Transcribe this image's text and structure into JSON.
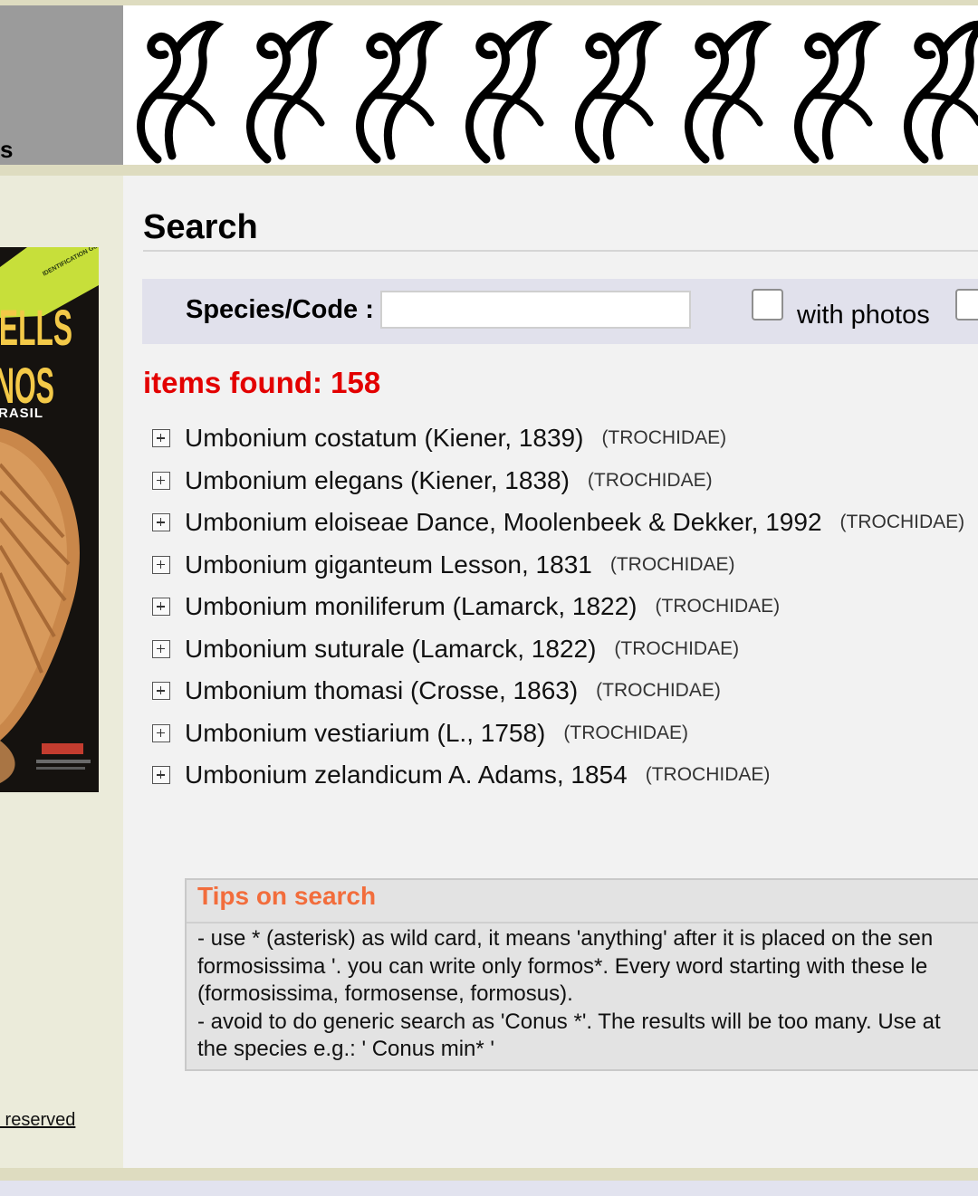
{
  "header": {
    "left_text": "s",
    "banner_icon": "decorative-wave-pattern-icon"
  },
  "sidebar": {
    "book_cover": {
      "title_line1": "HELLS",
      "title_line2": "NOS",
      "title_line3": "RASIL",
      "ribbon": "IDENTIFICATION GUIDE"
    },
    "footer_link": "s reserved"
  },
  "main": {
    "title": "Search",
    "search": {
      "species_label": "Species/Code :",
      "species_value": "",
      "with_photos_label": "with photos",
      "with_photos_checked": false
    },
    "items_found_label": "items found:",
    "items_found_count": "158",
    "results": [
      {
        "name": "Umbonium costatum (Kiener, 1839)",
        "family": "(TROCHIDAE)"
      },
      {
        "name": "Umbonium elegans (Kiener, 1838)",
        "family": "(TROCHIDAE)"
      },
      {
        "name": "Umbonium eloiseae Dance, Moolenbeek & Dekker, 1992",
        "family": "(TROCHIDAE)"
      },
      {
        "name": "Umbonium giganteum Lesson, 1831",
        "family": "(TROCHIDAE)"
      },
      {
        "name": "Umbonium moniliferum (Lamarck, 1822)",
        "family": "(TROCHIDAE)"
      },
      {
        "name": "Umbonium suturale (Lamarck, 1822)",
        "family": "(TROCHIDAE)"
      },
      {
        "name": "Umbonium thomasi (Crosse, 1863)",
        "family": "(TROCHIDAE)"
      },
      {
        "name": "Umbonium vestiarium (L., 1758)",
        "family": "(TROCHIDAE)"
      },
      {
        "name": "Umbonium zelandicum A. Adams, 1854",
        "family": "(TROCHIDAE)"
      }
    ],
    "tips": {
      "title": "Tips on search",
      "body": "- use * (asterisk) as wild card, it means 'anything' after it is placed on the sen\nformosissima '. you can write only formos*. Every word starting with these le\n(formosissima, formosense, formosus).\n- avoid to do generic search as 'Conus *'. The results will be too many. Use at\nthe species e.g.: ' Conus min* '"
    }
  },
  "colors": {
    "accent_red": "#e30000",
    "tips_orange": "#f26d3c",
    "header_gray": "#9b9b9b",
    "strip_beige": "#dedcc0"
  }
}
